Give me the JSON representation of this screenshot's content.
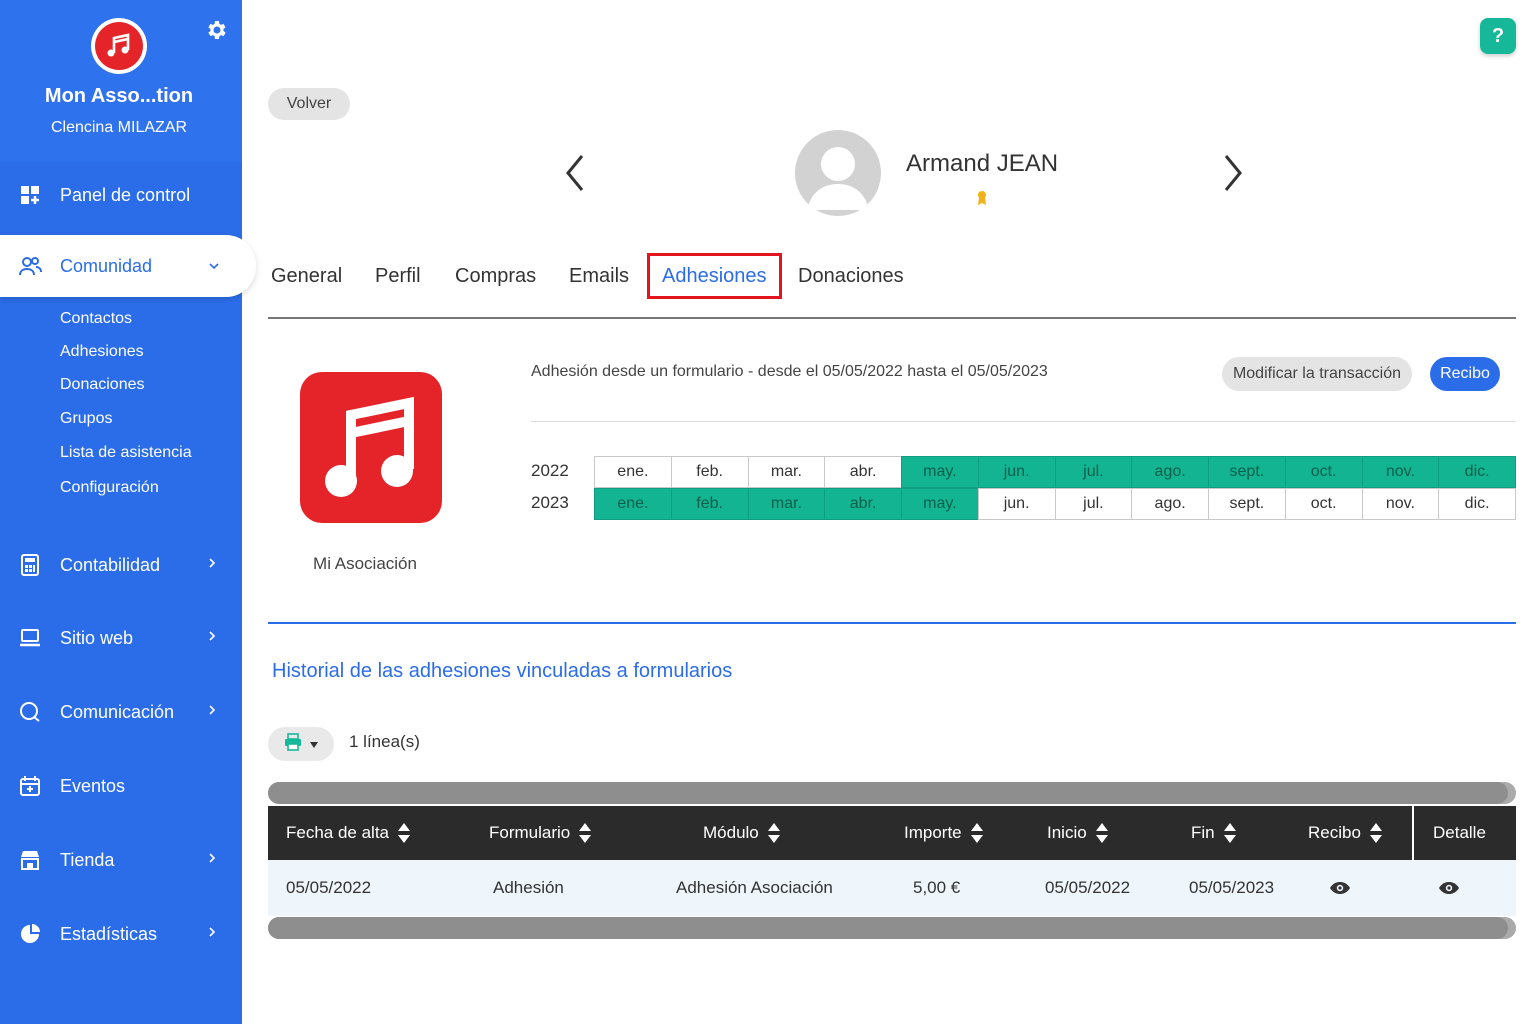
{
  "sidebar": {
    "app_title": "Mon Asso...tion",
    "user_name": "Clencina MILAZAR",
    "nav": {
      "panel": "Panel de control",
      "comunidad": "Comunidad",
      "contabilidad": "Contabilidad",
      "sitio_web": "Sitio web",
      "comunicacion": "Comunicación",
      "eventos": "Eventos",
      "tienda": "Tienda",
      "estadisticas": "Estadísticas"
    },
    "comunidad_sub": [
      "Contactos",
      "Adhesiones",
      "Donaciones",
      "Grupos",
      "Lista de asistencia",
      "Configuración"
    ]
  },
  "header": {
    "back_label": "Volver",
    "help_label": "?",
    "person_name": "Armand JEAN"
  },
  "tabs": [
    "General",
    "Perfil",
    "Compras",
    "Emails",
    "Adhesiones",
    "Donaciones"
  ],
  "membership": {
    "org_name": "Mi Asociación",
    "description": "Adhesión desde un formulario - desde el 05/05/2022 hasta el 05/05/2023",
    "modify_label": "Modificar la transacción",
    "receipt_label": "Recibo",
    "years": [
      {
        "year": "2022",
        "months": [
          "ene.",
          "feb.",
          "mar.",
          "abr.",
          "may.",
          "jun.",
          "jul.",
          "ago.",
          "sept.",
          "oct.",
          "nov.",
          "dic."
        ],
        "active_from": 4,
        "active_to": 11
      },
      {
        "year": "2023",
        "months": [
          "ene.",
          "feb.",
          "mar.",
          "abr.",
          "may.",
          "jun.",
          "jul.",
          "ago.",
          "sept.",
          "oct.",
          "nov.",
          "dic."
        ],
        "active_from": 0,
        "active_to": 4
      }
    ],
    "active_color": "#13b491"
  },
  "history": {
    "title": "Historial de las adhesiones vinculadas a formularios",
    "line_count": "1 línea(s)",
    "columns": [
      "Fecha de alta",
      "Formulario",
      "Módulo",
      "Importe",
      "Inicio",
      "Fin",
      "Recibo",
      "Detalle"
    ],
    "rows": [
      {
        "fecha": "05/05/2022",
        "formulario": "Adhesión",
        "modulo": "Adhesión Asociación",
        "importe": "5,00 €",
        "inicio": "05/05/2022",
        "fin": "05/05/2023"
      }
    ]
  },
  "colors": {
    "primary": "#2b6de8",
    "accent_green": "#17b79a",
    "brand_red": "#e5242a",
    "highlight_border": "#e4141e"
  }
}
